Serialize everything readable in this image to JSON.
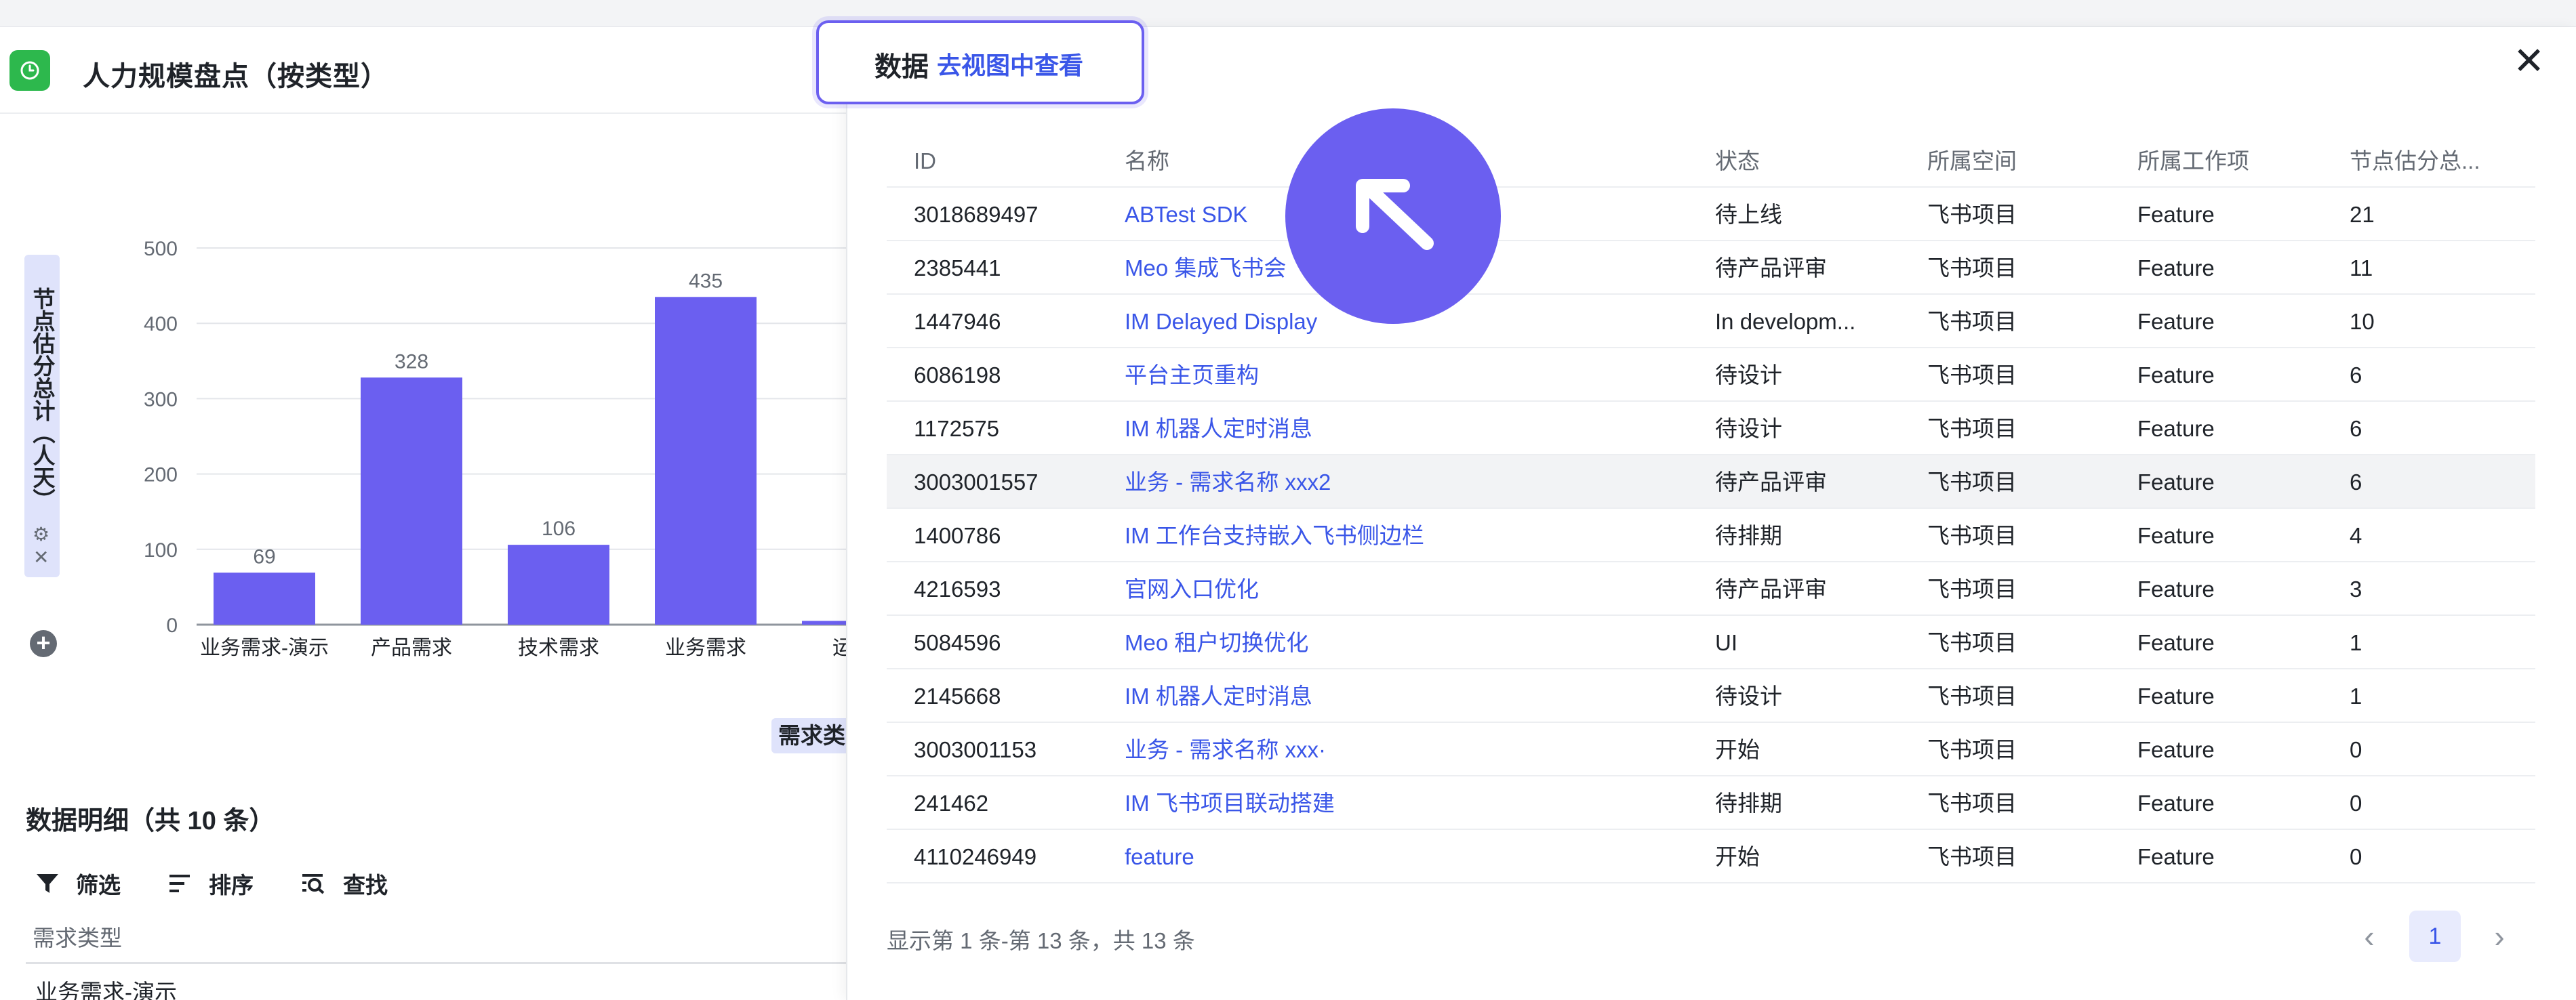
{
  "left": {
    "title": "人力规模盘点（按类型）",
    "detail_title": "数据明细（共 10 条）",
    "toolbar": {
      "filter": "筛选",
      "sort": "排序",
      "find": "查找"
    },
    "column_header": "需求类型",
    "first_row": "业务需求-演示"
  },
  "chart_data": {
    "type": "bar",
    "categories": [
      "业务需求-演示",
      "产品需求",
      "技术需求",
      "业务需求",
      "运营"
    ],
    "values": [
      69,
      328,
      106,
      435,
      5
    ],
    "ylabel": "节点估分总计（人天）",
    "xlabel": "需求类",
    "yticks": [
      0,
      100,
      200,
      300,
      400,
      500
    ],
    "ylim": [
      0,
      500
    ],
    "grid": true,
    "bar_color": "#6b5ff0"
  },
  "drawer": {
    "tab_label": "数据",
    "tab_link": "去视图中查看",
    "columns": [
      "ID",
      "名称",
      "状态",
      "所属空间",
      "所属工作项",
      "节点估分总..."
    ],
    "rows": [
      {
        "id": "3018689497",
        "name": "ABTest SDK",
        "status": "待上线",
        "space": "飞书项目",
        "item": "Feature",
        "score": "21"
      },
      {
        "id": "2385441",
        "name": "Meo 集成飞书会",
        "status": "待产品评审",
        "space": "飞书项目",
        "item": "Feature",
        "score": "11"
      },
      {
        "id": "1447946",
        "name": "IM Delayed Display",
        "status": "In developm...",
        "space": "飞书项目",
        "item": "Feature",
        "score": "10"
      },
      {
        "id": "6086198",
        "name": "平台主页重构",
        "status": "待设计",
        "space": "飞书项目",
        "item": "Feature",
        "score": "6"
      },
      {
        "id": "1172575",
        "name": "IM 机器人定时消息",
        "status": "待设计",
        "space": "飞书项目",
        "item": "Feature",
        "score": "6"
      },
      {
        "id": "3003001557",
        "name": "业务 - 需求名称 xxx2",
        "status": "待产品评审",
        "space": "飞书项目",
        "item": "Feature",
        "score": "6"
      },
      {
        "id": "1400786",
        "name": "IM 工作台支持嵌入飞书侧边栏",
        "status": "待排期",
        "space": "飞书项目",
        "item": "Feature",
        "score": "4"
      },
      {
        "id": "4216593",
        "name": "官网入口优化",
        "status": "待产品评审",
        "space": "飞书项目",
        "item": "Feature",
        "score": "3"
      },
      {
        "id": "5084596",
        "name": "Meo 租户切换优化",
        "status": "UI",
        "space": "飞书项目",
        "item": "Feature",
        "score": "1"
      },
      {
        "id": "2145668",
        "name": "IM 机器人定时消息",
        "status": "待设计",
        "space": "飞书项目",
        "item": "Feature",
        "score": "1"
      },
      {
        "id": "3003001153",
        "name": "业务 - 需求名称 xxx·",
        "status": "开始",
        "space": "飞书项目",
        "item": "Feature",
        "score": "0"
      },
      {
        "id": "241462",
        "name": "IM 飞书项目联动搭建",
        "status": "待排期",
        "space": "飞书项目",
        "item": "Feature",
        "score": "0"
      },
      {
        "id": "4110246949",
        "name": "feature",
        "status": "开始",
        "space": "飞书项目",
        "item": "Feature",
        "score": "0"
      }
    ],
    "pager": {
      "summary": "显示第 1 条-第 13 条，共 13 条",
      "current_page": "1"
    }
  },
  "icons": {
    "app": "clock-icon",
    "close": "close-icon",
    "cursor": "arrow-up-left-icon"
  },
  "colors": {
    "accent": "#6b5ff0",
    "link": "#3a56e8",
    "app_icon": "#2db84d"
  }
}
